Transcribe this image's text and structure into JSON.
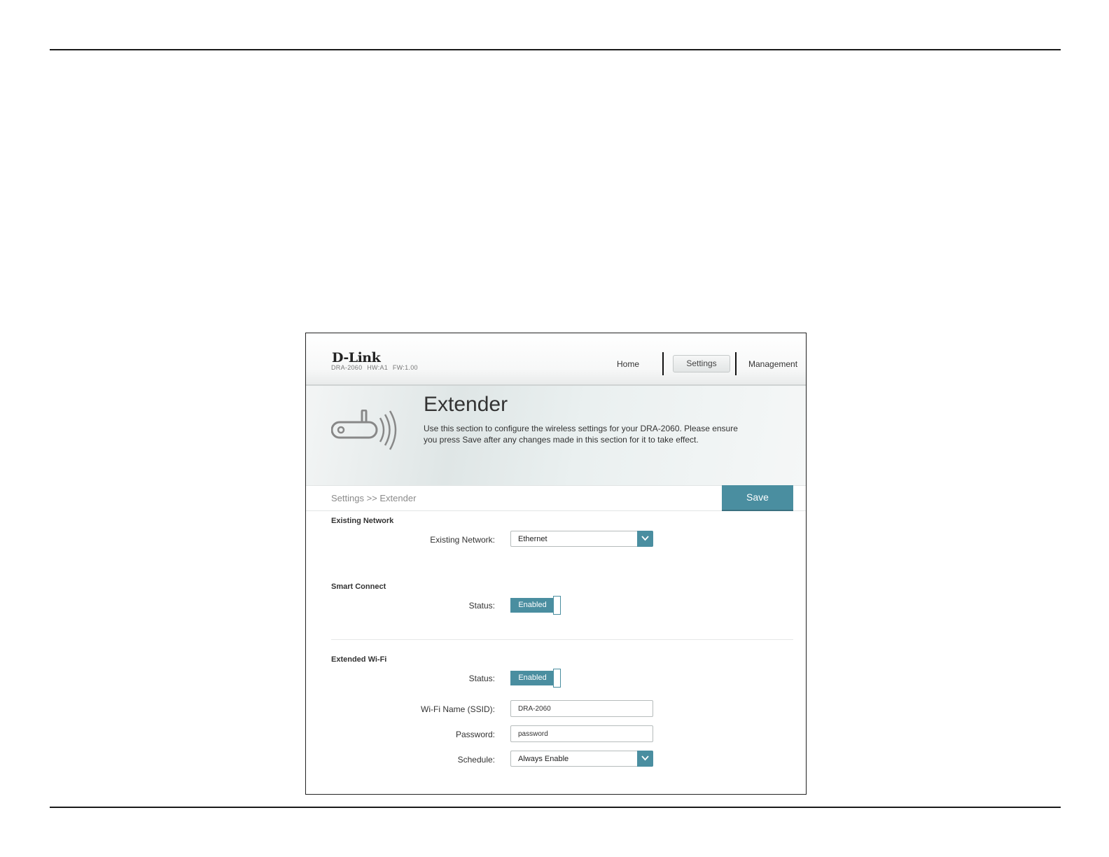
{
  "header": {
    "logo": "D-Link",
    "model_info": "DRA-2060 HW:A1 FW:1.00",
    "nav": {
      "home": "Home",
      "settings": "Settings",
      "management": "Management"
    }
  },
  "hero": {
    "title": "Extender",
    "description": "Use this section to configure the wireless settings for your DRA-2060. Please ensure you press Save after any changes made in this section for it to take effect."
  },
  "breadcrumb": "Settings >> Extender",
  "save_label": "Save",
  "existing_network": {
    "section_title": "Existing Network",
    "label": "Existing Network:",
    "value": "Ethernet"
  },
  "smart_connect": {
    "section_title": "Smart Connect",
    "status_label": "Status:",
    "status_value": "Enabled"
  },
  "extended_wifi": {
    "section_title": "Extended Wi-Fi",
    "status_label": "Status:",
    "status_value": "Enabled",
    "ssid_label": "Wi-Fi Name (SSID):",
    "ssid_value": "DRA-2060",
    "password_label": "Password:",
    "password_value": "password",
    "schedule_label": "Schedule:",
    "schedule_value": "Always Enable"
  },
  "colors": {
    "accent": "#4a8ea0"
  }
}
